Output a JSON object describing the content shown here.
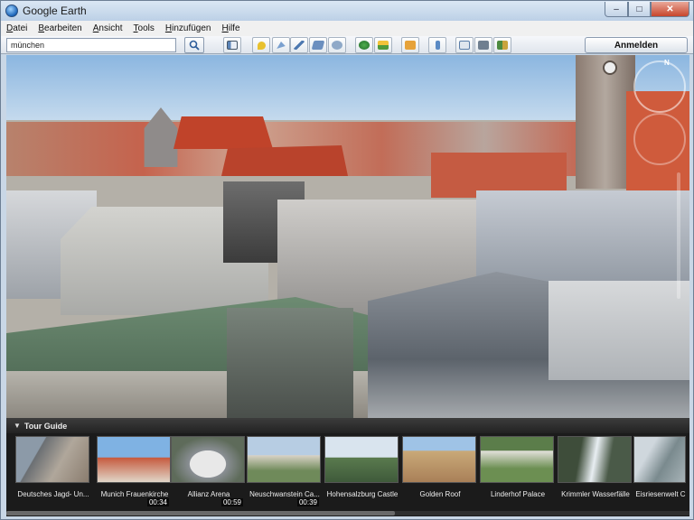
{
  "window": {
    "title": "Google Earth",
    "controls": {
      "minimize": "–",
      "maximize": "□",
      "close": "✕"
    }
  },
  "menu": [
    "Datei",
    "Bearbeiten",
    "Ansicht",
    "Tools",
    "Hinzufügen",
    "Hilfe"
  ],
  "search": {
    "value": "münchen"
  },
  "toolbar": {
    "icons": [
      "sidebar-icon",
      "placemark-icon",
      "polygon-icon",
      "path-icon",
      "image-overlay-icon",
      "tour-icon",
      "historical-imagery-icon",
      "sun-icon",
      "planets-icon",
      "ruler-icon",
      "email-icon",
      "print-icon",
      "map-export-icon"
    ],
    "login_label": "Anmelden"
  },
  "navigation": {
    "north_label": "N"
  },
  "tour_guide": {
    "title": "Tour Guide",
    "items": [
      {
        "label": "Deutsches Jagd- Un...",
        "duration": ""
      },
      {
        "label": "Munich Frauenkirche",
        "duration": "00:34"
      },
      {
        "label": "Allianz Arena",
        "duration": "00:59"
      },
      {
        "label": "Neuschwanstein Ca...",
        "duration": "00:39"
      },
      {
        "label": "Hohensalzburg Castle",
        "duration": ""
      },
      {
        "label": "Golden Roof",
        "duration": ""
      },
      {
        "label": "Linderhof Palace",
        "duration": ""
      },
      {
        "label": "Krimmler Wasserfälle",
        "duration": ""
      },
      {
        "label": "Eisriesenwelt C",
        "duration": ""
      }
    ]
  },
  "colors": {
    "roof": "#c8553d",
    "sky": "#9ec4e6",
    "tour_bg": "#1b1b1b"
  }
}
